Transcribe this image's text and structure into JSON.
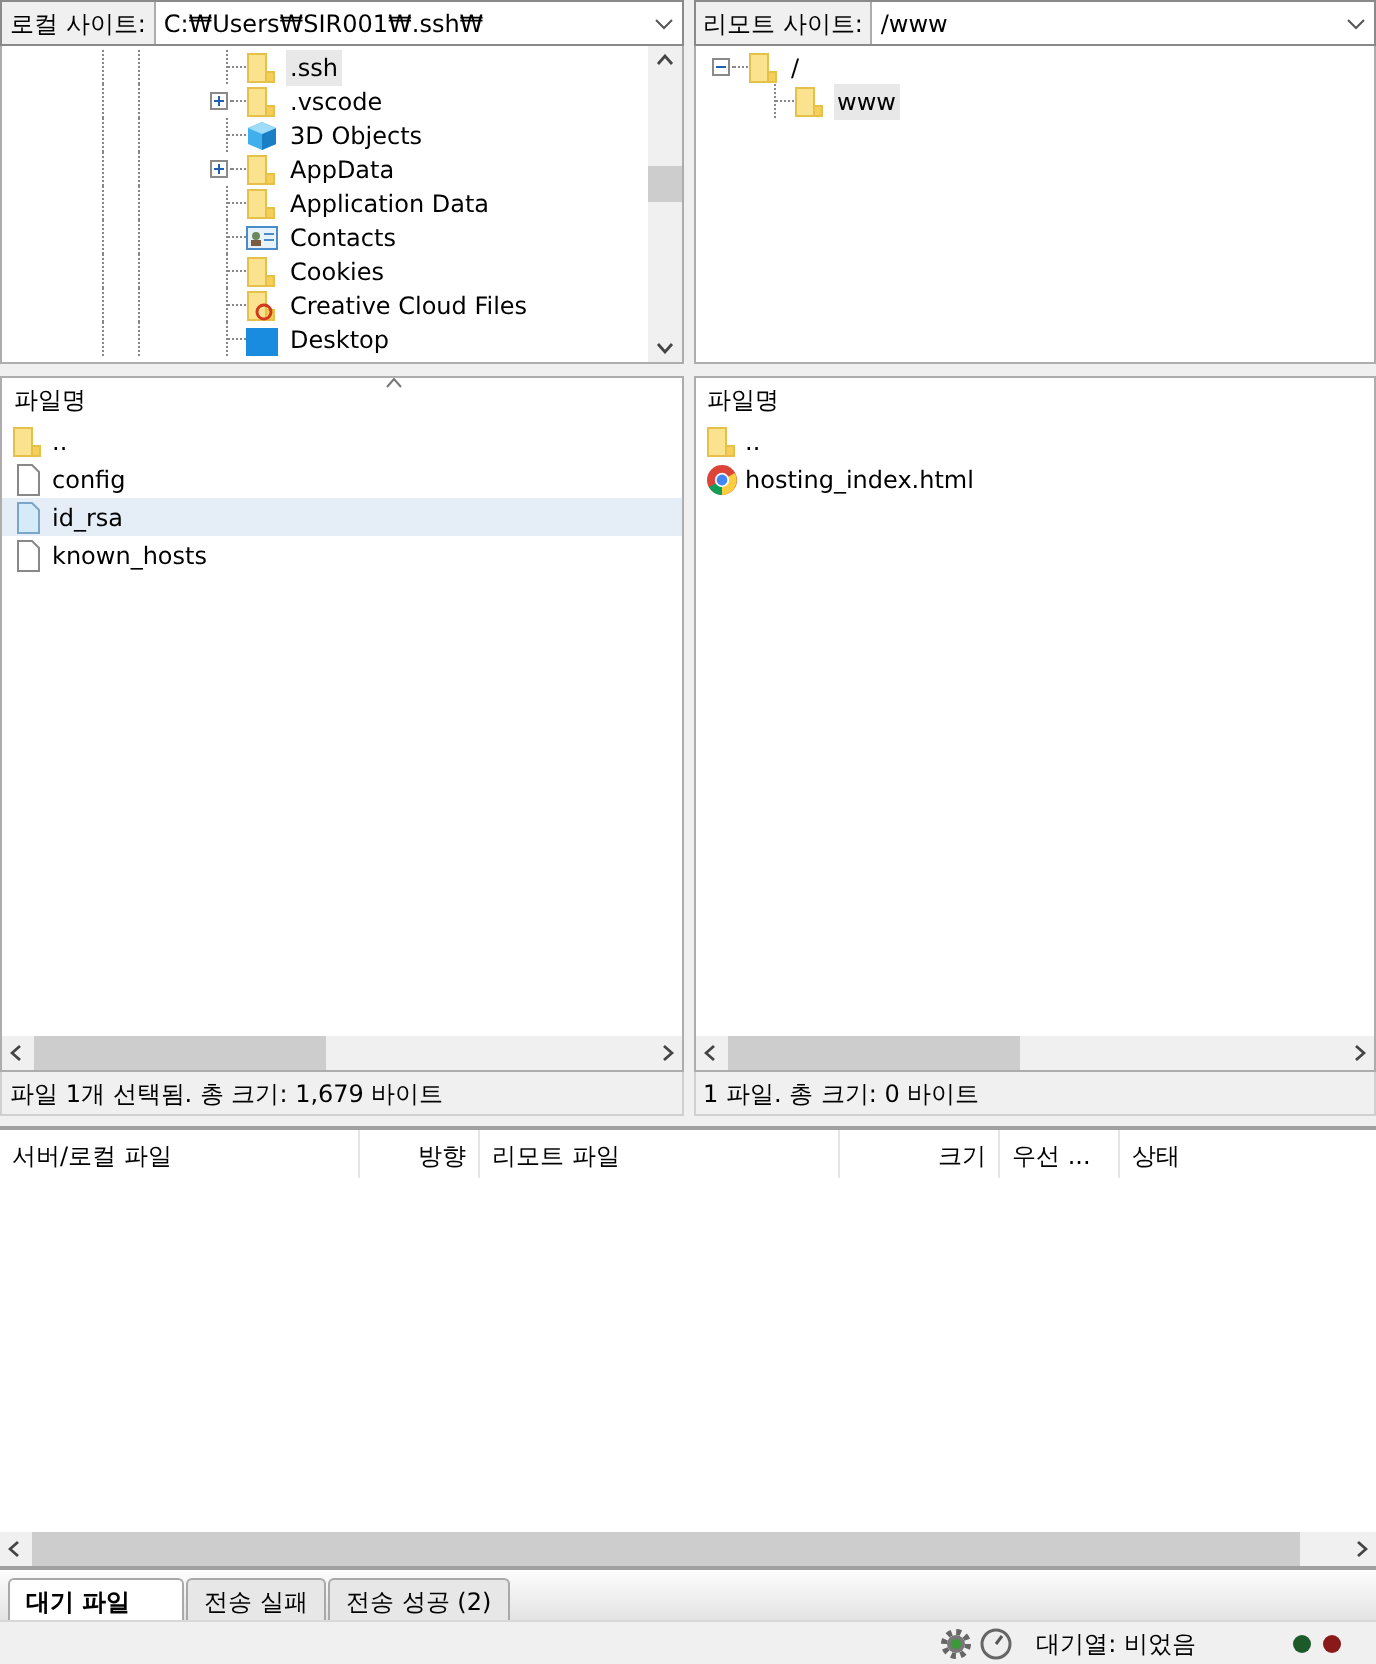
{
  "local": {
    "site_label": "로컬 사이트:",
    "path": "C:₩Users₩SIR001₩.ssh₩",
    "tree": [
      {
        "label": ".ssh",
        "kind": "folder",
        "selected": true
      },
      {
        "label": ".vscode",
        "kind": "folder",
        "selected": false,
        "expanded": false
      },
      {
        "label": "3D Objects",
        "kind": "cube",
        "selected": false
      },
      {
        "label": "AppData",
        "kind": "folder",
        "selected": false,
        "expanded": false
      },
      {
        "label": "Application Data",
        "kind": "folder",
        "selected": false
      },
      {
        "label": "Contacts",
        "kind": "contacts",
        "selected": false
      },
      {
        "label": "Cookies",
        "kind": "folder",
        "selected": false
      },
      {
        "label": "Creative Cloud Files",
        "kind": "cloud",
        "selected": false
      },
      {
        "label": "Desktop",
        "kind": "desktop",
        "selected": false
      }
    ],
    "column": "파일명",
    "files": [
      {
        "name": "..",
        "kind": "folder",
        "selected": false
      },
      {
        "name": "config",
        "kind": "file",
        "selected": false
      },
      {
        "name": "id_rsa",
        "kind": "key",
        "selected": true
      },
      {
        "name": "known_hosts",
        "kind": "file",
        "selected": false
      }
    ],
    "status": "파일 1개 선택됨. 총 크기: 1,679 바이트"
  },
  "remote": {
    "site_label": "리모트 사이트:",
    "path": "/www",
    "tree": [
      {
        "label": "/",
        "kind": "folder",
        "selected": false,
        "expanded": true,
        "children": [
          {
            "label": "www",
            "kind": "folder",
            "selected": true
          }
        ]
      }
    ],
    "column": "파일명",
    "files": [
      {
        "name": "..",
        "kind": "folder",
        "selected": false
      },
      {
        "name": "hosting_index.html",
        "kind": "html",
        "selected": false
      }
    ],
    "status": "1 파일. 총 크기: 0 바이트"
  },
  "queue": {
    "columns": [
      {
        "label": "서버/로컬 파일"
      },
      {
        "label": "방향"
      },
      {
        "label": "리모트 파일"
      },
      {
        "label": "크기"
      },
      {
        "label": "우선 ..."
      },
      {
        "label": "상태"
      }
    ]
  },
  "tabs": [
    {
      "label": "대기 파일",
      "selected": true
    },
    {
      "label": "전송 실패",
      "selected": false
    },
    {
      "label": "전송 성공 (2)",
      "selected": false
    }
  ],
  "status_bar": {
    "queue": "대기열: 비었음"
  }
}
